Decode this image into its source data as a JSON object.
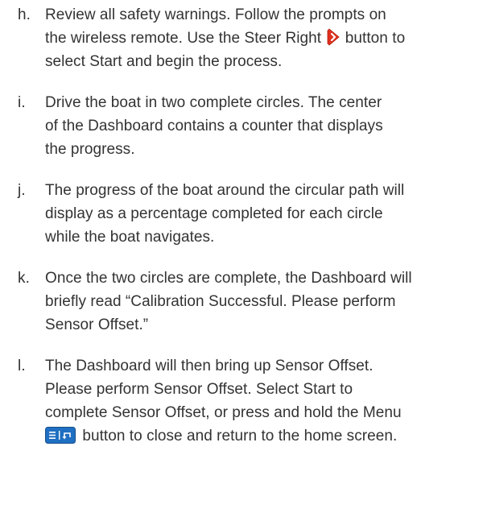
{
  "steps": [
    {
      "letter": "h.",
      "lines": [
        "Review all safety warnings. Follow the prompts on",
        "the wireless remote. Use the Steer Right",
        "button to",
        "select Start and begin the process."
      ]
    },
    {
      "letter": "i.",
      "lines": [
        "Drive the boat in two complete circles. The center",
        "of the Dashboard contains a counter that displays",
        "the progress."
      ]
    },
    {
      "letter": "j.",
      "lines": [
        "The progress of the boat around the circular path will",
        "display as a percentage completed for each circle",
        "while the boat navigates."
      ]
    },
    {
      "letter": "k.",
      "lines": [
        "Once the two circles are complete, the Dashboard will",
        "briefly read “Calibration Successful. Please perform",
        "Sensor Offset.”"
      ]
    },
    {
      "letter": "l.",
      "lines": [
        "The Dashboard will then bring up Sensor Offset.",
        "Please perform Sensor Offset. Select Start to",
        "complete Sensor Offset, or press and hold the Menu",
        "button to close and return to the home screen."
      ]
    }
  ],
  "icons": {
    "steer_right": "steer-right-icon",
    "menu": "menu-icon"
  },
  "colors": {
    "text": "#333333",
    "steer_icon": "#e0301e",
    "menu_icon": "#1f6fc2"
  }
}
